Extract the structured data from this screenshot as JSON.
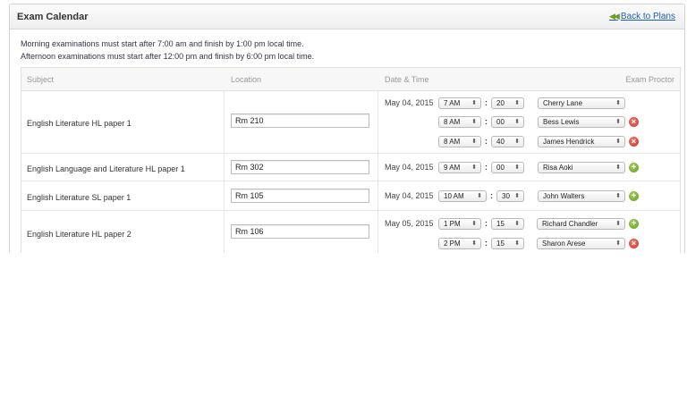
{
  "header": {
    "title": "Exam Calendar",
    "back_link": "Back to Plans",
    "back_icon": "double-chevron-left"
  },
  "rules": {
    "morning": "Morning examinations must start after 7:00 am and finish by 1:00 pm local time.",
    "afternoon": "Afternoon examinations must start after 12:00 pm and finish by 6:00 pm local time."
  },
  "table": {
    "headers": {
      "subject": "Subject",
      "location": "Location",
      "datetime": "Date & Time",
      "proctor": "Exam Proctor"
    },
    "rows": [
      {
        "subject": "English Literature HL paper 1",
        "location": "Rm 210",
        "date": "May 04, 2015",
        "slots": [
          {
            "hour": "7 AM",
            "minute": "20",
            "proctor": "Cherry Lane",
            "action": "none"
          },
          {
            "hour": "8 AM",
            "minute": "00",
            "proctor": "Bess Lewis",
            "action": "remove"
          },
          {
            "hour": "8 AM",
            "minute": "40",
            "proctor": "James Hendrick",
            "action": "remove"
          }
        ]
      },
      {
        "subject": "English Language and Literature HL paper 1",
        "location": "Rm 302",
        "date": "May 04, 2015",
        "slots": [
          {
            "hour": "9 AM",
            "minute": "00",
            "proctor": "Risa Aoki",
            "action": "add"
          }
        ]
      },
      {
        "subject": "English Literature SL paper 1",
        "location": "Rm 105",
        "date": "May 04, 2015",
        "slots": [
          {
            "hour": "10 AM",
            "minute": "30",
            "proctor": "John Walters",
            "action": "add"
          }
        ]
      },
      {
        "subject": "English Literature HL paper 2",
        "location": "Rm 106",
        "date": "May 05, 2015",
        "slots": [
          {
            "hour": "1 PM",
            "minute": "15",
            "proctor": "Richard Chandler",
            "action": "add"
          },
          {
            "hour": "2 PM",
            "minute": "15",
            "proctor": "Sharon Arese",
            "action": "remove"
          }
        ]
      }
    ]
  },
  "colors": {
    "link": "#1a5fb4",
    "add": "#6aa82a",
    "remove": "#d33b2f"
  }
}
